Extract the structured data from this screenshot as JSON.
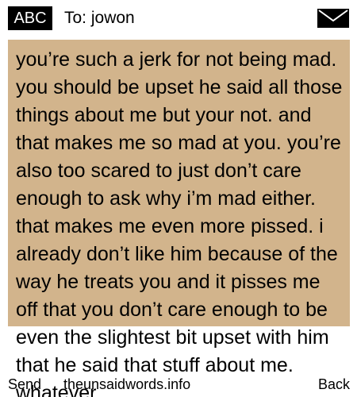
{
  "header": {
    "mode_label": "ABC",
    "recipient": "To: jowon",
    "envelope_icon": "envelope-icon"
  },
  "message": {
    "body": "you’re such a jerk for not being mad. you should be upset he said all those things about me but your not. and that makes me so mad at you. you’re also too scared to just don’t care enough to ask why i’m mad either. that makes me even more pissed. i already don’t like him because of the way he treats you and it pisses me off that you don’t care enough to be even the slightest bit upset with him that he said that stuff about me. whatever"
  },
  "softkeys": {
    "left": "Send",
    "center": "theunsaidwords.info",
    "right": "Back"
  },
  "colors": {
    "panel": "#d2b48c",
    "badge": "#000000"
  }
}
